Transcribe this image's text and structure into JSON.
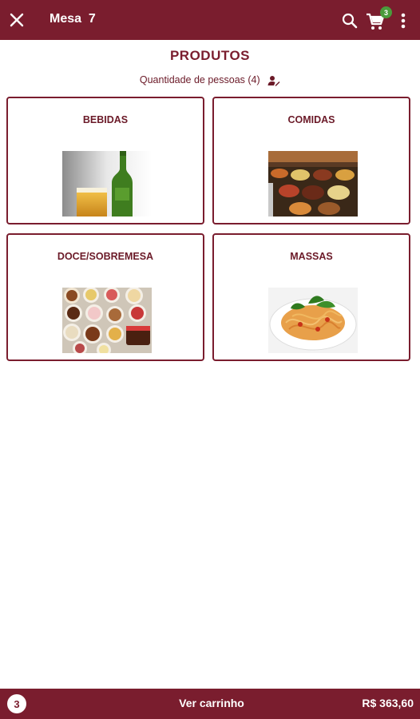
{
  "header": {
    "title": "Mesa  7",
    "cart_count": "3",
    "bar_color": "#7a1d2e",
    "icons": [
      "close-icon",
      "search-icon",
      "cart-icon",
      "more-vertical-icon"
    ]
  },
  "page": {
    "title": "PRODUTOS",
    "people_label": "Quantidade de pessoas (4)"
  },
  "categories": [
    {
      "label": "BEBIDAS",
      "image": "beer-bottle-and-glass"
    },
    {
      "label": "COMIDAS",
      "image": "buffet-food"
    },
    {
      "label": "DOCE/SOBREMESA",
      "image": "desserts-platter"
    },
    {
      "label": "MASSAS",
      "image": "spaghetti-plate"
    }
  ],
  "footer": {
    "item_count": "3",
    "view_cart_label": "Ver carrinho",
    "total": "R$ 363,60"
  }
}
